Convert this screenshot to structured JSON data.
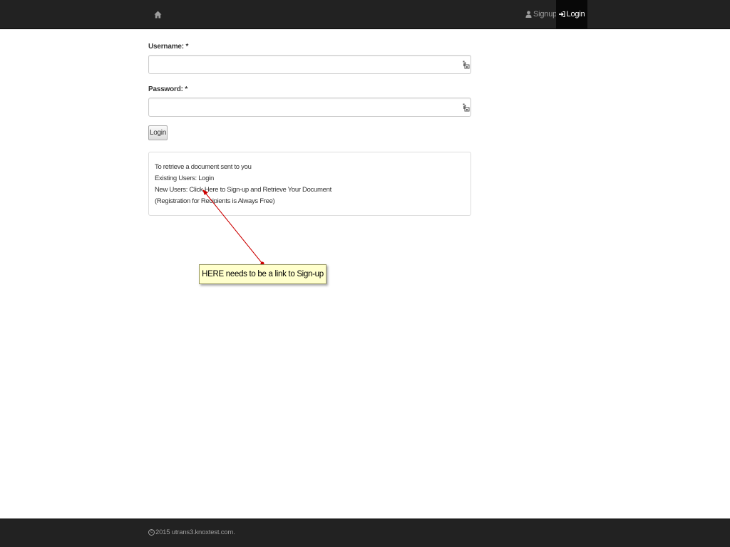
{
  "navbar": {
    "home_icon": "home-icon",
    "signup_icon": "user-icon",
    "signup_label": "Signup",
    "login_icon": "log-in-icon",
    "login_label": "Login"
  },
  "form": {
    "username_label": "Username: *",
    "username_value": "",
    "password_label": "Password: *",
    "password_value": "",
    "field_icon": "key-icon",
    "login_button": "Login"
  },
  "info": {
    "line1": "To retrieve a document sent to you",
    "line2_prefix": "Existing Users: ",
    "line2_link": "Login",
    "line3_prefix": "New Users: Click ",
    "line3_link": "Here",
    "line3_suffix": " to Sign-up and Retrieve Your Document",
    "line4": "(Registration for Recipients is Always Free)"
  },
  "annotation": {
    "text": "HERE needs to be a link to Sign-up",
    "arrow_color": "#cc0000",
    "box_color": "#ffffcc"
  },
  "footer": {
    "copyright_icon": "copyright-icon",
    "text": "2015 utrans3.knoxtest.com."
  }
}
